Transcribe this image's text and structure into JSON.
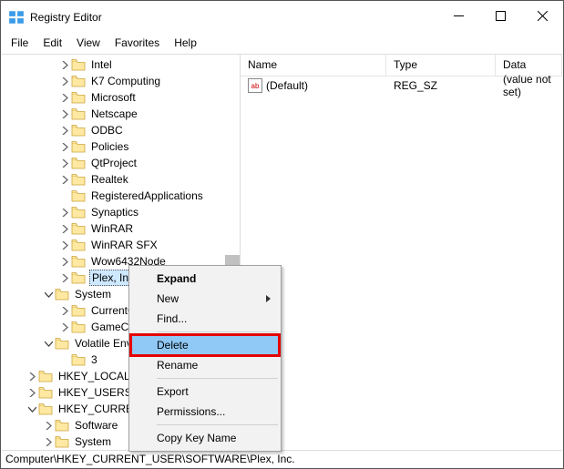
{
  "window": {
    "title": "Registry Editor"
  },
  "menu": {
    "file": "File",
    "edit": "Edit",
    "view": "View",
    "favorites": "Favorites",
    "help": "Help"
  },
  "tree": {
    "items": [
      {
        "depth": 3,
        "exp": "r",
        "label": "Intel"
      },
      {
        "depth": 3,
        "exp": "r",
        "label": "K7 Computing"
      },
      {
        "depth": 3,
        "exp": "r",
        "label": "Microsoft"
      },
      {
        "depth": 3,
        "exp": "r",
        "label": "Netscape"
      },
      {
        "depth": 3,
        "exp": "r",
        "label": "ODBC"
      },
      {
        "depth": 3,
        "exp": "r",
        "label": "Policies"
      },
      {
        "depth": 3,
        "exp": "r",
        "label": "QtProject"
      },
      {
        "depth": 3,
        "exp": "r",
        "label": "Realtek"
      },
      {
        "depth": 3,
        "exp": "",
        "label": "RegisteredApplications"
      },
      {
        "depth": 3,
        "exp": "r",
        "label": "Synaptics"
      },
      {
        "depth": 3,
        "exp": "r",
        "label": "WinRAR"
      },
      {
        "depth": 3,
        "exp": "r",
        "label": "WinRAR SFX"
      },
      {
        "depth": 3,
        "exp": "r",
        "label": "Wow6432Node"
      },
      {
        "depth": 3,
        "exp": "r",
        "label": "Plex, Inc.",
        "selected": true
      },
      {
        "depth": 2,
        "exp": "d",
        "label": "System"
      },
      {
        "depth": 3,
        "exp": "r",
        "label": "CurrentControlSet"
      },
      {
        "depth": 3,
        "exp": "r",
        "label": "GameConfigStore"
      },
      {
        "depth": 2,
        "exp": "d",
        "label": "Volatile Environment"
      },
      {
        "depth": 3,
        "exp": "",
        "label": "3"
      },
      {
        "depth": 1,
        "exp": "r",
        "label": "HKEY_LOCAL_MACHINE"
      },
      {
        "depth": 1,
        "exp": "r",
        "label": "HKEY_USERS"
      },
      {
        "depth": 1,
        "exp": "d",
        "label": "HKEY_CURRENT_CONFIG"
      },
      {
        "depth": 2,
        "exp": "r",
        "label": "Software"
      },
      {
        "depth": 2,
        "exp": "r",
        "label": "System"
      }
    ]
  },
  "list": {
    "headers": {
      "name": "Name",
      "type": "Type",
      "data": "Data"
    },
    "rows": [
      {
        "name": "(Default)",
        "type": "REG_SZ",
        "data": "(value not set)",
        "icon": "ab"
      }
    ]
  },
  "context": {
    "expand": "Expand",
    "new": "New",
    "find": "Find...",
    "delete": "Delete",
    "rename": "Rename",
    "export": "Export",
    "permissions": "Permissions...",
    "copykey": "Copy Key Name"
  },
  "status": {
    "path": "Computer\\HKEY_CURRENT_USER\\SOFTWARE\\Plex, Inc."
  }
}
